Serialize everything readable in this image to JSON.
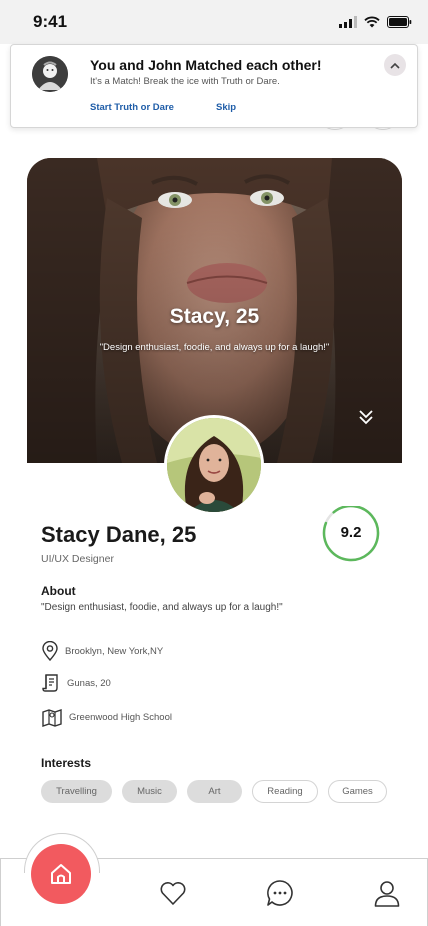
{
  "status_bar": {
    "time": "9:41"
  },
  "notification": {
    "title": "You and John Matched each other!",
    "subtitle": "It's a Match! Break the ice with Truth or Dare.",
    "primary_action": "Start Truth or Dare",
    "secondary_action": "Skip"
  },
  "card": {
    "title": "Stacy, 25",
    "quote": "\"Design enthusiast, foodie, and always up for a laugh!\""
  },
  "profile": {
    "name": "Stacy Dane, 25",
    "job": "UI/UX Designer",
    "score": "9.2",
    "about_title": "About",
    "about_text": "\"Design enthusiast, foodie, and always up for a laugh!\"",
    "location": "Brooklyn, New York,NY",
    "religion": "Gunas, 20",
    "school": "Greenwood High School"
  },
  "interests": {
    "title": "Interests",
    "items": [
      "Travelling",
      "Music",
      "Art",
      "Reading",
      "Games"
    ]
  },
  "colors": {
    "accent": "#f25a5f",
    "score_ring": "#5cb85c",
    "link": "#1f5da8"
  }
}
